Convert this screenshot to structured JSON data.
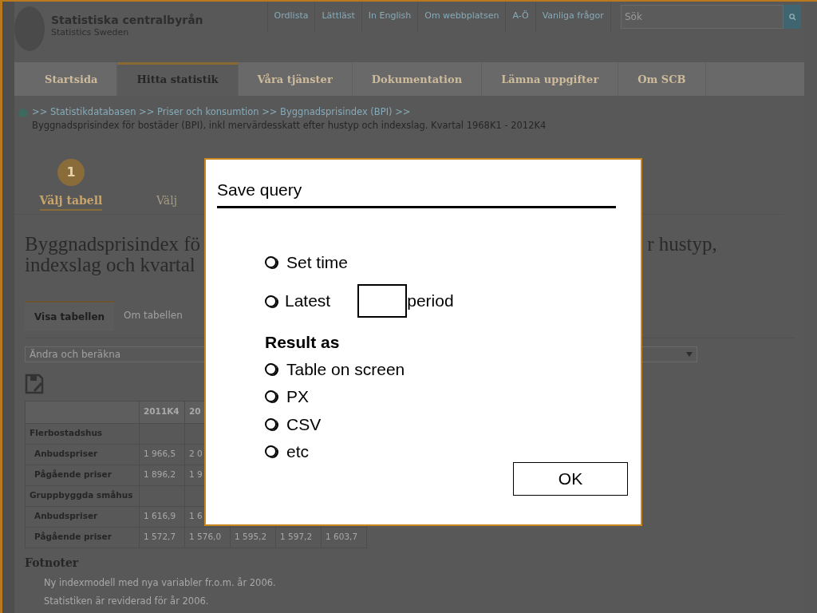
{
  "header": {
    "org_name": "Statistiska centralbyrån",
    "org_subtitle": "Statistics Sweden"
  },
  "top_links": [
    "Ordlista",
    "Lättläst",
    "In English",
    "Om webbplatsen",
    "A-Ö",
    "Vanliga frågor"
  ],
  "search": {
    "placeholder": "Sök"
  },
  "nav_tabs": [
    {
      "label": "Startsida",
      "selected": false
    },
    {
      "label": "Hitta statistik",
      "selected": true
    },
    {
      "label": "Våra tjänster",
      "selected": false
    },
    {
      "label": "Dokumentation",
      "selected": false
    },
    {
      "label": "Lämna uppgifter",
      "selected": false
    },
    {
      "label": "Om SCB",
      "selected": false
    }
  ],
  "breadcrumb": {
    "path": ">> Statistikdatabasen >> Priser och konsumtion >> Byggnadsprisindex (BPI) >>",
    "title": "Byggnadsprisindex för bostäder (BPI), inkl mervärdesskatt efter hustyp och indexslag. Kvartal 1968K1 - 2012K4"
  },
  "steps": [
    {
      "number": "1",
      "label": "Välj tabell",
      "selected": true
    },
    {
      "label": "Välj",
      "selected": false
    }
  ],
  "heading": [
    "Byggnadsprisindex fö",
    "r hustyp,",
    "indexslag och kvartal"
  ],
  "content_tabs": [
    {
      "label": "Visa tabellen",
      "selected": true
    },
    {
      "label": "Om tabellen",
      "selected": false
    }
  ],
  "select": {
    "value": "Ändra och beräkna"
  },
  "table": {
    "columns": [
      "2011K4",
      "20"
    ],
    "rows": [
      {
        "kind": "group",
        "label": "Flerbostadshus",
        "cells": []
      },
      {
        "kind": "item",
        "label": "Anbudspriser",
        "cells": [
          "1 966,5",
          "2 0"
        ]
      },
      {
        "kind": "item",
        "label": "Pågående priser",
        "cells": [
          "1 896,2",
          "1 9"
        ]
      },
      {
        "kind": "group",
        "label": "Gruppbyggda småhus",
        "cells": []
      },
      {
        "kind": "item",
        "label": "Anbudspriser",
        "cells": [
          "1 616,9",
          "1 6"
        ]
      },
      {
        "kind": "item",
        "label": "Pågående priser",
        "cells": [
          "1 572,7",
          "1 576,0",
          "1 595,2",
          "1 597,2",
          "1 603,7"
        ]
      }
    ]
  },
  "footnotes": {
    "title": "Fotnoter",
    "items": [
      "Ny indexmodell med nya variabler fr.o.m. år 2006.",
      "Statistiken är reviderad för år 2006."
    ]
  },
  "dialog": {
    "title": "Save query",
    "options": [
      {
        "kind": "plain",
        "label": "Set time",
        "selected": false
      },
      {
        "kind": "input",
        "label": "Latest",
        "suffix": "period",
        "selected": false
      }
    ],
    "result_label": "Result as",
    "formats": [
      {
        "label": "Table on screen",
        "selected": false
      },
      {
        "label": "PX",
        "selected": false
      },
      {
        "label": "CSV",
        "selected": false
      },
      {
        "label": "etc",
        "selected": false
      }
    ],
    "ok": "OK"
  }
}
